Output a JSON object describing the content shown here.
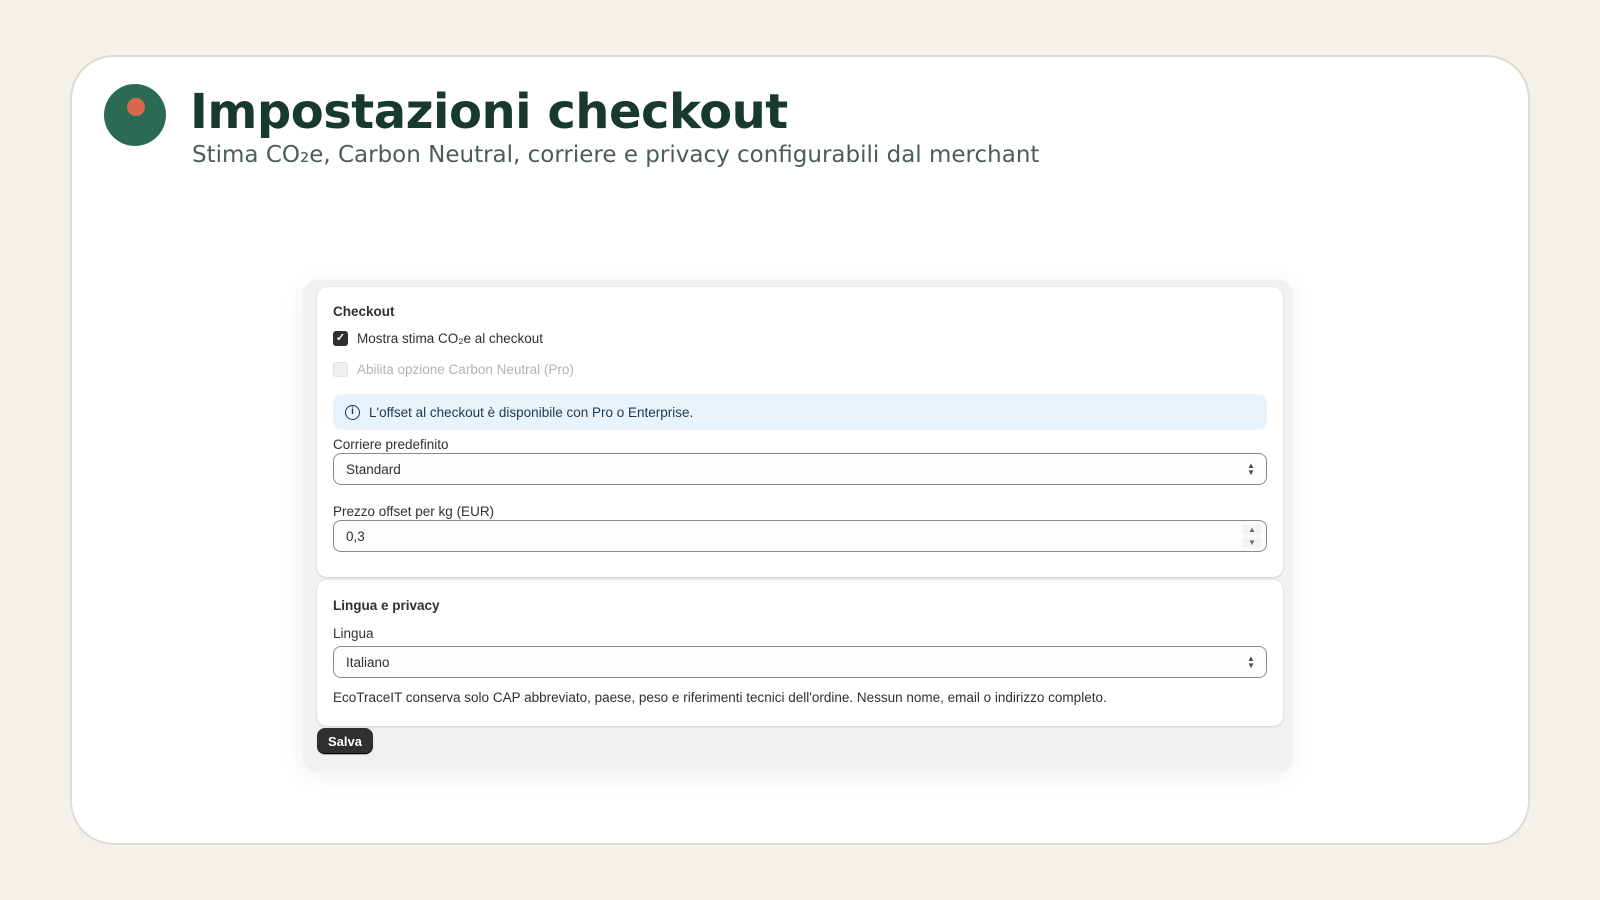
{
  "header": {
    "title": "Impostazioni checkout",
    "subtitle": "Stima CO₂e, Carbon Neutral, corriere e privacy configurabili dal merchant"
  },
  "checkout": {
    "section_title": "Checkout",
    "show_estimate": {
      "label": "Mostra stima CO₂e al checkout",
      "checked": true
    },
    "carbon_neutral": {
      "label": "Abilita opzione Carbon Neutral (Pro)",
      "checked": false,
      "disabled": true
    },
    "banner": {
      "icon": "info-icon",
      "text": "L'offset al checkout è disponibile con Pro o Enterprise."
    },
    "carrier": {
      "label": "Corriere predefinito",
      "value": "Standard"
    },
    "offset_price": {
      "label": "Prezzo offset per kg (EUR)",
      "value": "0,3"
    }
  },
  "privacy": {
    "section_title": "Lingua e privacy",
    "language": {
      "label": "Lingua",
      "value": "Italiano"
    },
    "note": "EcoTraceIT conserva solo CAP abbreviato, paese, peso e riferimenti tecnici dell'ordine. Nessun nome, email o indirizzo completo."
  },
  "actions": {
    "save_label": "Salva"
  },
  "colors": {
    "brand_green": "#2c6b53",
    "brand_accent": "#d6684e",
    "title": "#173a2c",
    "banner_bg": "#e9f3fc",
    "button": "#303030"
  }
}
